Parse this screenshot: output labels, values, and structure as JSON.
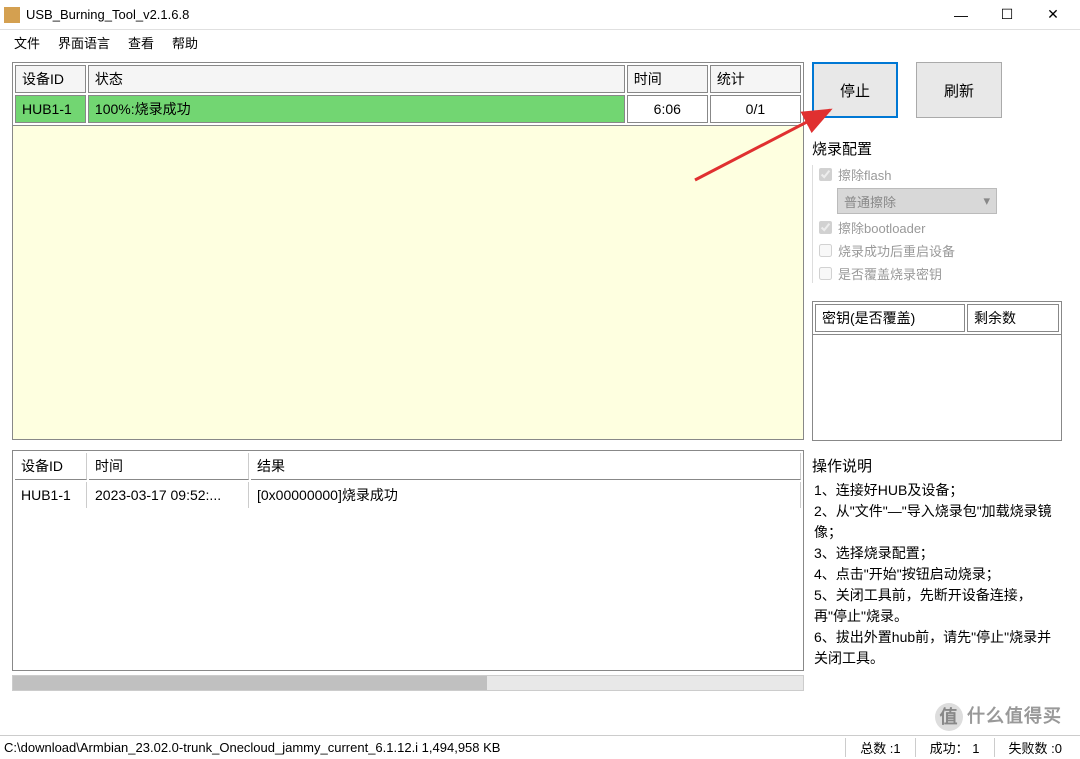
{
  "window": {
    "title": "USB_Burning_Tool_v2.1.6.8"
  },
  "menu": {
    "file": "文件",
    "language": "界面语言",
    "view": "查看",
    "help": "帮助"
  },
  "deviceTable": {
    "headers": {
      "id": "设备ID",
      "status": "状态",
      "time": "时间",
      "stat": "统计"
    },
    "rows": [
      {
        "id": "HUB1-1",
        "status": "100%:烧录成功",
        "time": "6:06",
        "stat": "0/1"
      }
    ]
  },
  "logTable": {
    "headers": {
      "id": "设备ID",
      "time": "时间",
      "result": "结果"
    },
    "rows": [
      {
        "id": "HUB1-1",
        "time": "2023-03-17 09:52:...",
        "result": "[0x00000000]烧录成功"
      }
    ]
  },
  "buttons": {
    "stop": "停止",
    "refresh": "刷新"
  },
  "config": {
    "title": "烧录配置",
    "eraseFlash": "擦除flash",
    "eraseMode": "普通擦除",
    "eraseBootloader": "擦除bootloader",
    "rebootAfter": "烧录成功后重启设备",
    "overwriteKey": "是否覆盖烧录密钥"
  },
  "keyTable": {
    "col1": "密钥(是否覆盖)",
    "col2": "剩余数"
  },
  "instructions": {
    "title": "操作说明",
    "items": [
      "1、连接好HUB及设备；",
      "2、从\"文件\"—\"导入烧录包\"加载烧录镜像；",
      "3、选择烧录配置；",
      "4、点击\"开始\"按钮启动烧录；",
      "5、关闭工具前，先断开设备连接，再\"停止\"烧录。",
      "6、拔出外置hub前，请先\"停止\"烧录并关闭工具。"
    ]
  },
  "statusbar": {
    "file": "C:\\download\\Armbian_23.02.0-trunk_Onecloud_jammy_current_6.1.12.i 1,494,958 KB",
    "totalLabel": "总数 :",
    "totalValue": "1",
    "successLabel": "成功：",
    "successValue": "1",
    "failLabel": "失败数 :",
    "failValue": "0"
  },
  "watermark": "什么值得买"
}
